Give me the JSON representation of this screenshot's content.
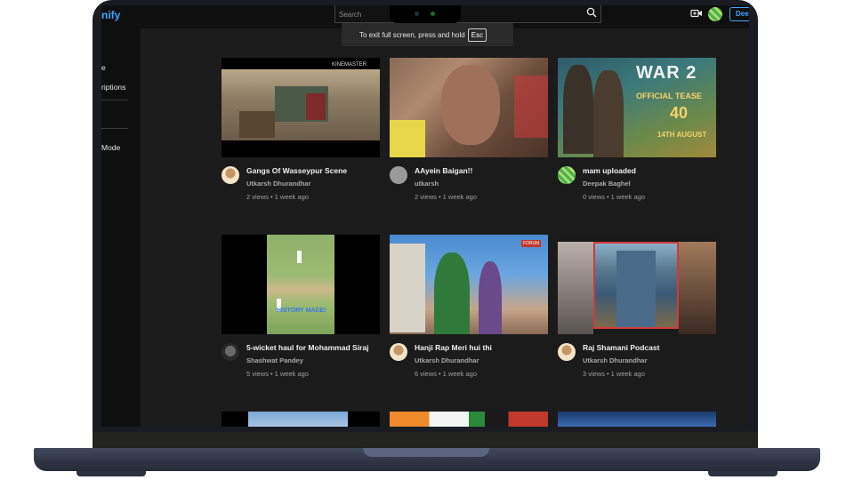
{
  "app": {
    "logo_text": "nify",
    "search_placeholder": "Search",
    "sign_in_label": "Dee"
  },
  "fullscreen_tip": {
    "text": "To exit full screen, press and hold",
    "key": "Esc"
  },
  "sidebar": {
    "items": [
      "e",
      "riptions",
      "Mode"
    ]
  },
  "videos": [
    {
      "title": "Gangs Of Wasseypur Scene",
      "channel": "Utkarsh Dhurandhar",
      "views": "2 views",
      "age": "1 week ago",
      "thumb_caption": "KINEMASTER"
    },
    {
      "title": "AAyein Baigan!!",
      "channel": "utkarsh",
      "views": "2 views",
      "age": "1 week ago"
    },
    {
      "title": "mam uploaded",
      "channel": "Deepak Baghel",
      "views": "0 views",
      "age": "1 week ago",
      "thumb_caption": "WAR 2",
      "thumb_subcaption": "OFFICIAL TEASE",
      "thumb_badge": "40",
      "thumb_date": "14TH AUGUST"
    },
    {
      "title": "5-wicket haul for Mohammad Siraj",
      "channel": "Shashwat Pandey",
      "views": "5 views",
      "age": "1 week ago",
      "thumb_caption": "HISTORY MADE!"
    },
    {
      "title": "Hanji Rap Meri hui thi",
      "channel": "Utkarsh Dhurandhar",
      "views": "6 views",
      "age": "1 week ago",
      "thumb_caption": "FORUM"
    },
    {
      "title": "Raj Shamani Podcast",
      "channel": "Utkarsh Dhurandhar",
      "views": "3 views",
      "age": "1 week ago"
    }
  ],
  "colors": {
    "accent": "#3ea6ff",
    "background": "#0f0f0f",
    "content_bg": "#1b1b1b",
    "text": "#f1f1f1",
    "secondary_text": "#a8a8a8"
  }
}
